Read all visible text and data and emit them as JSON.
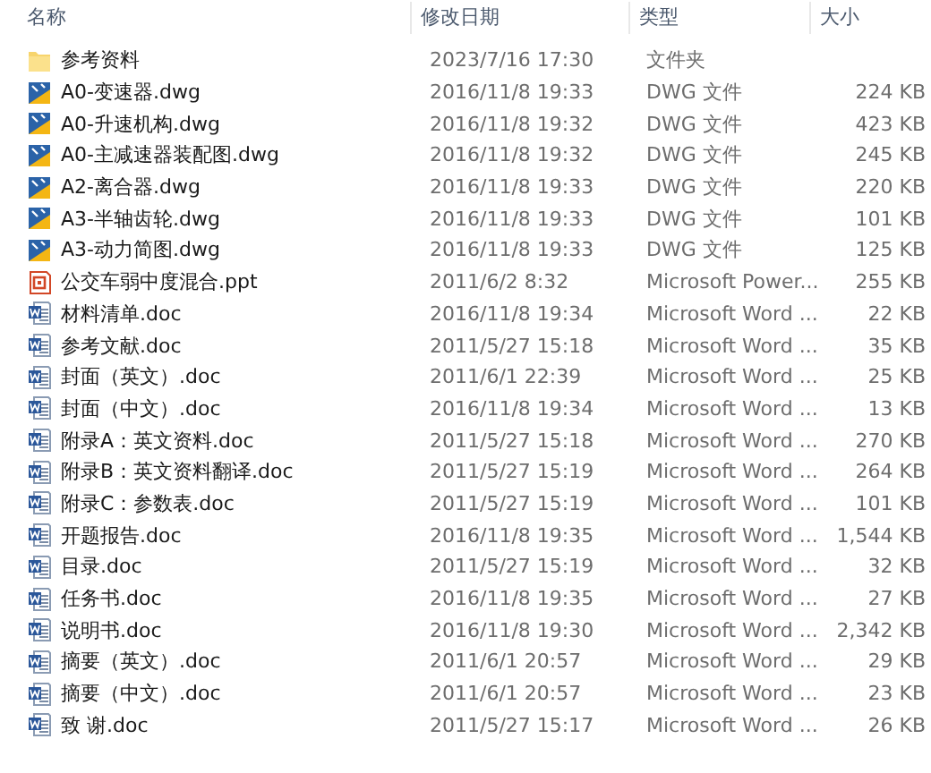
{
  "columns": [
    "名称",
    "修改日期",
    "类型",
    "大小"
  ],
  "files": [
    {
      "kind": "folder",
      "name": "参考资料",
      "date": "2023/7/16 17:30",
      "type": "文件夹"
    },
    {
      "kind": "dwg",
      "name": "A0-变速器.dwg",
      "date": "2016/11/8 19:33",
      "type": "DWG 文件",
      "size": "224 KB"
    },
    {
      "kind": "dwg",
      "name": "A0-升速机构.dwg",
      "date": "2016/11/8 19:32",
      "type": "DWG 文件",
      "size": "423 KB"
    },
    {
      "kind": "dwg",
      "name": "A0-主减速器装配图.dwg",
      "date": "2016/11/8 19:32",
      "type": "DWG 文件",
      "size": "245 KB"
    },
    {
      "kind": "dwg",
      "name": "A2-离合器.dwg",
      "date": "2016/11/8 19:33",
      "type": "DWG 文件",
      "size": "220 KB"
    },
    {
      "kind": "dwg",
      "name": "A3-半轴齿轮.dwg",
      "date": "2016/11/8 19:33",
      "type": "DWG 文件",
      "size": "101 KB"
    },
    {
      "kind": "dwg",
      "name": "A3-动力简图.dwg",
      "date": "2016/11/8 19:33",
      "type": "DWG 文件",
      "size": "125 KB"
    },
    {
      "kind": "ppt",
      "name": "公交车弱中度混合.ppt",
      "date": "2011/6/2 8:32",
      "type": "Microsoft Power...",
      "size": "255 KB"
    },
    {
      "kind": "doc",
      "name": "材料清单.doc",
      "date": "2016/11/8 19:34",
      "type": "Microsoft Word ...",
      "size": "22 KB"
    },
    {
      "kind": "doc",
      "name": "参考文献.doc",
      "date": "2011/5/27 15:18",
      "type": "Microsoft Word ...",
      "size": "35 KB"
    },
    {
      "kind": "doc",
      "name": "封面（英文）.doc",
      "date": "2011/6/1 22:39",
      "type": "Microsoft Word ...",
      "size": "25 KB"
    },
    {
      "kind": "doc",
      "name": "封面（中文）.doc",
      "date": "2016/11/8 19:34",
      "type": "Microsoft Word ...",
      "size": "13 KB"
    },
    {
      "kind": "doc",
      "name": "附录A：英文资料.doc",
      "date": "2011/5/27 15:18",
      "type": "Microsoft Word ...",
      "size": "270 KB"
    },
    {
      "kind": "doc",
      "name": "附录B：英文资料翻译.doc",
      "date": "2011/5/27 15:19",
      "type": "Microsoft Word ...",
      "size": "264 KB"
    },
    {
      "kind": "doc",
      "name": "附录C：参数表.doc",
      "date": "2011/5/27 15:19",
      "type": "Microsoft Word ...",
      "size": "101 KB"
    },
    {
      "kind": "doc",
      "name": "开题报告.doc",
      "date": "2016/11/8 19:35",
      "type": "Microsoft Word ...",
      "size": "1,544 KB"
    },
    {
      "kind": "doc",
      "name": "目录.doc",
      "date": "2011/5/27 15:19",
      "type": "Microsoft Word ...",
      "size": "32 KB"
    },
    {
      "kind": "doc",
      "name": "任务书.doc",
      "date": "2016/11/8 19:35",
      "type": "Microsoft Word ...",
      "size": "27 KB"
    },
    {
      "kind": "doc",
      "name": "说明书.doc",
      "date": "2016/11/8 19:30",
      "type": "Microsoft Word ...",
      "size": "2,342 KB"
    },
    {
      "kind": "doc",
      "name": "摘要（英文）.doc",
      "date": "2011/6/1 20:57",
      "type": "Microsoft Word ...",
      "size": "29 KB"
    },
    {
      "kind": "doc",
      "name": "摘要（中文）.doc",
      "date": "2011/6/1 20:57",
      "type": "Microsoft Word ...",
      "size": "23 KB"
    },
    {
      "kind": "doc",
      "name": "致 谢.doc",
      "date": "2011/5/27 15:17",
      "type": "Microsoft Word ...",
      "size": "26 KB"
    }
  ]
}
